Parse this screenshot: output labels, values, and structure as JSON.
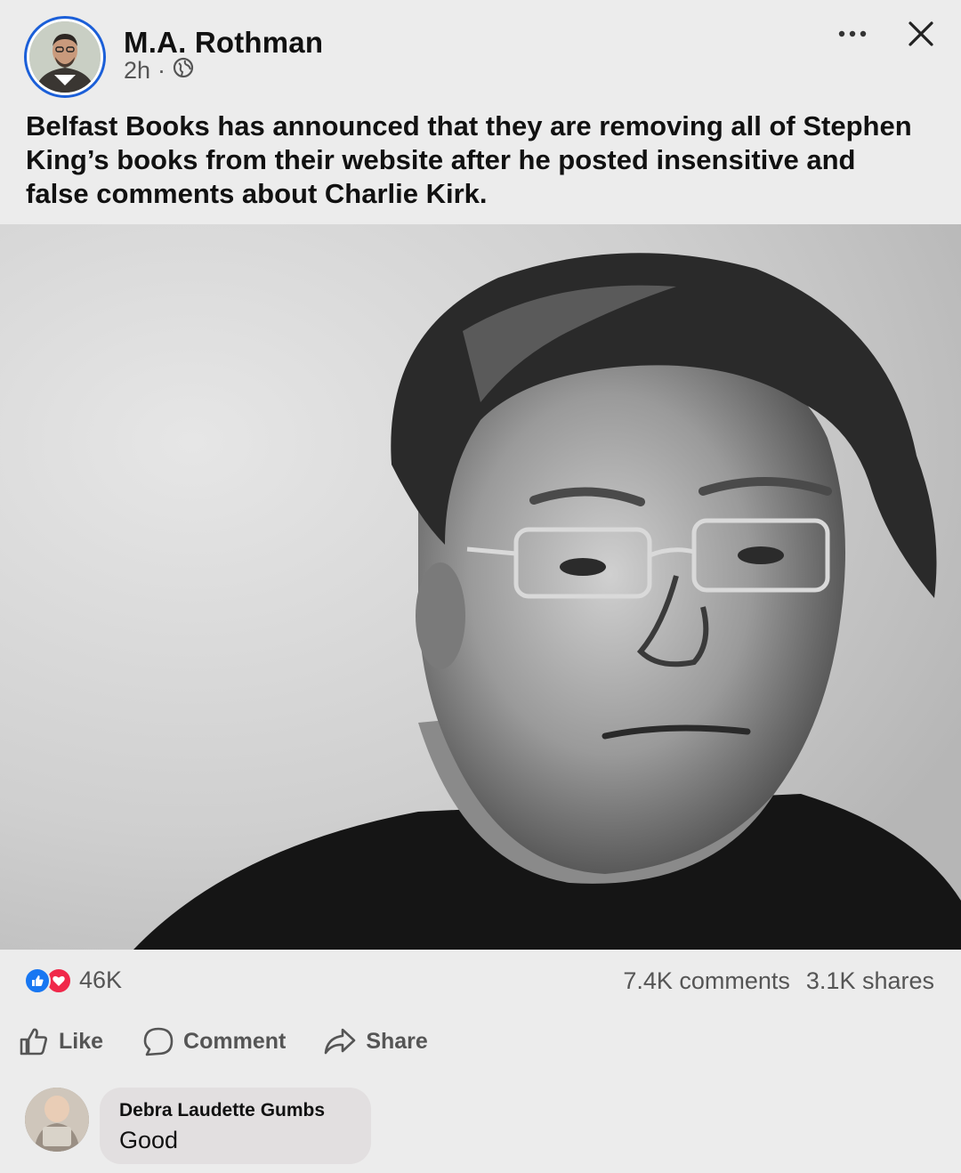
{
  "post": {
    "author_name": "M.A. Rothman",
    "time_ago": "2h",
    "separator": "·",
    "visibility_icon": "globe-icon",
    "body_text": "Belfast Books has announced that they are removing all of Stephen King’s books from their website after he posted insensitive and false comments about Charlie Kirk."
  },
  "header_actions": {
    "more_icon": "more-horizontal-icon",
    "close_icon": "close-icon"
  },
  "stats": {
    "reaction_count": "46K",
    "reaction_icons": [
      "like-icon",
      "love-icon"
    ],
    "comments": "7.4K comments",
    "shares": "3.1K shares"
  },
  "actions": {
    "like_label": "Like",
    "comment_label": "Comment",
    "share_label": "Share"
  },
  "comment": {
    "author": "Debra Laudette Gumbs",
    "text": "Good"
  },
  "colors": {
    "background": "#ececec",
    "avatar_ring": "#1b5fd8",
    "like_blue": "#1877f2",
    "love_red": "#f0284a",
    "muted_text": "#555555"
  }
}
